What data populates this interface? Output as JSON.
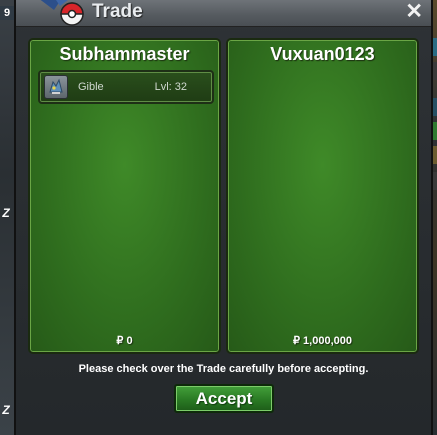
{
  "background": {
    "level_badge": "9",
    "side_marker": "Z"
  },
  "window": {
    "title": "Trade",
    "close_glyph": "✕"
  },
  "left_panel": {
    "player_name": "Subhammaster",
    "items": [
      {
        "name": "Gible",
        "level": "Lvl: 32",
        "icon": "gible-icon"
      }
    ],
    "money": "₽ 0"
  },
  "right_panel": {
    "player_name": "Vuxuan0123",
    "items": [],
    "money": "₽ 1,000,000"
  },
  "notice": "Please check over the Trade carefully before accepting.",
  "accept_label": "Accept",
  "colors": {
    "panel_green": "#2f6d1e",
    "button_green": "#2a7a24",
    "title_bar": "#555a5f"
  }
}
